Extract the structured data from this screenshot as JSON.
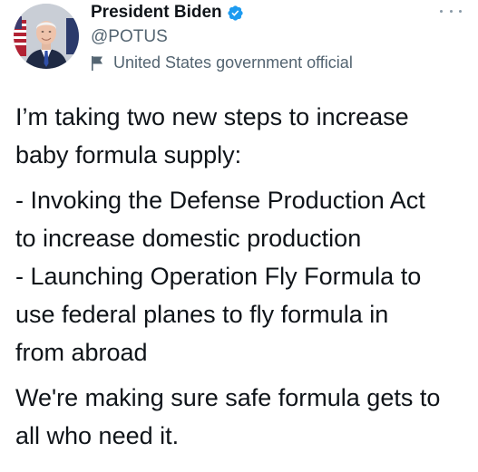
{
  "author": {
    "display_name": "President Biden",
    "handle": "@POTUS",
    "label": "United States government official",
    "verified": true
  },
  "icons": {
    "more": "more-horizontal-icon",
    "verified": "verified-badge-icon",
    "label": "flag-icon"
  },
  "colors": {
    "verified_blue": "#1d9bf0",
    "secondary_text": "#536471",
    "primary_text": "#0f1419"
  },
  "tweet": {
    "lines": {
      "l1": "I’m taking two new steps to increase",
      "l2": "baby formula supply:",
      "l3": "- Invoking the Defense Production Act",
      "l4": "to increase domestic production",
      "l5": "- Launching Operation Fly Formula to",
      "l6": "use federal planes to fly formula in",
      "l7": "from abroad",
      "l8": "We're making sure safe formula gets to",
      "l9": "all who need it."
    }
  }
}
